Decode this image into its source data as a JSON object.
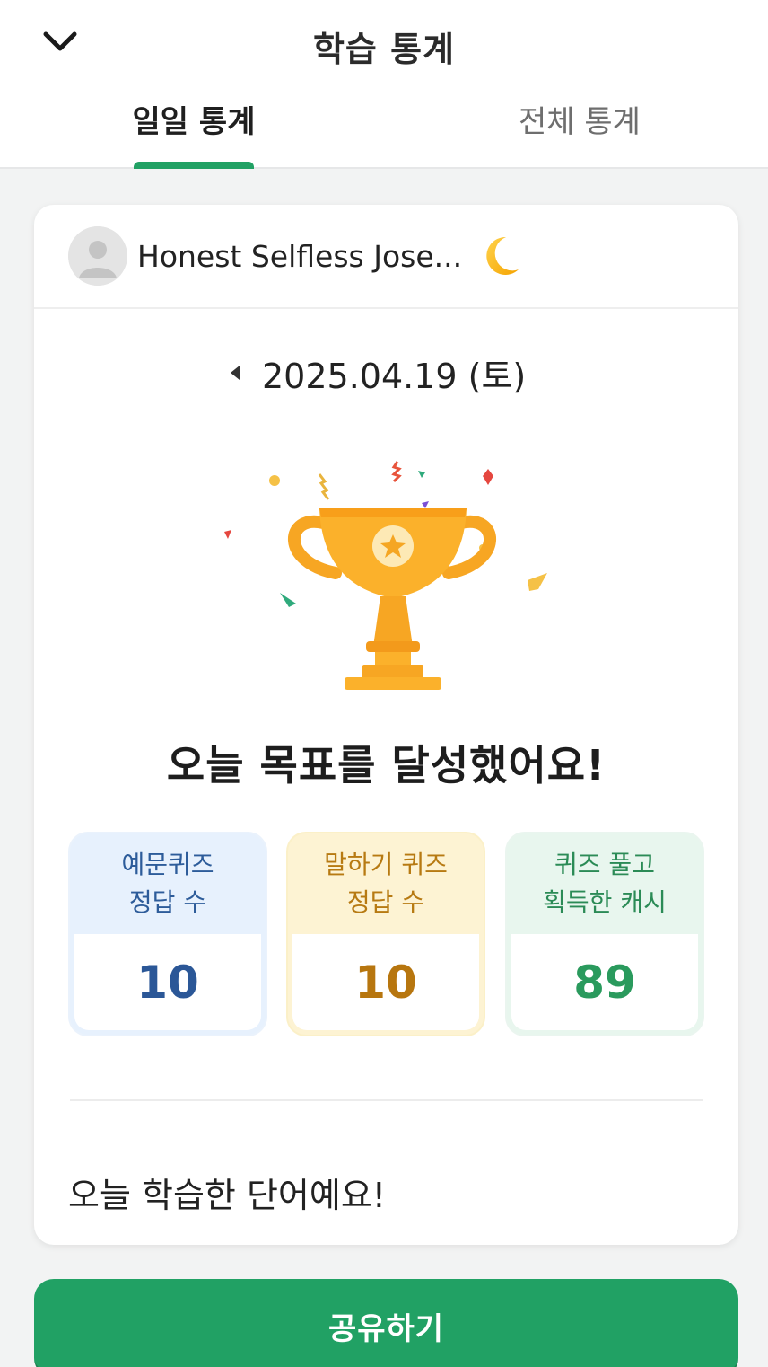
{
  "header": {
    "title": "학습 통계",
    "tabs": [
      {
        "label": "일일 통계",
        "active": true
      },
      {
        "label": "전체 통계",
        "active": false
      }
    ]
  },
  "profile": {
    "username": "Honest Selfless Jose..."
  },
  "date": {
    "text": "2025.04.19 (토)"
  },
  "goal": {
    "message": "오늘 목표를 달성했어요!"
  },
  "stats": [
    {
      "label_line1": "예문퀴즈",
      "label_line2": "정답 수",
      "value": "10"
    },
    {
      "label_line1": "말하기 퀴즈",
      "label_line2": "정답 수",
      "value": "10"
    },
    {
      "label_line1": "퀴즈 풀고",
      "label_line2": "획득한 캐시",
      "value": "89"
    }
  ],
  "words_section": {
    "title": "오늘 학습한 단어예요!"
  },
  "share_button": {
    "label": "공유하기"
  },
  "colors": {
    "accent": "#21a164",
    "trophy": "#f9a825"
  }
}
